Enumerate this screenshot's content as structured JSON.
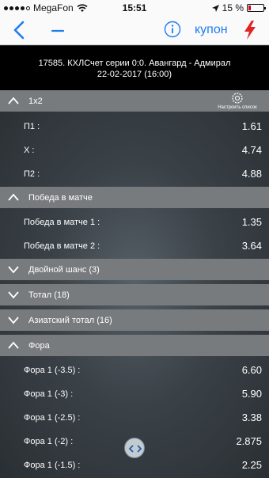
{
  "statusbar": {
    "carrier": "MegaFon",
    "time": "15:51",
    "battery_text": "15 %",
    "battery_level": 0.15
  },
  "navbar": {
    "coupon_label": "купон",
    "accent_color": "#1e7cf2",
    "bolt_color": "#e02424"
  },
  "match": {
    "title": "17585. КХЛСчет серии 0:0. Авангард - Адмирал",
    "datetime": "22-02-2017 (16:00)"
  },
  "settings": {
    "label": "Настроить список"
  },
  "sections": [
    {
      "title": "1x2",
      "expanded": true,
      "rows": [
        {
          "label": "П1 :",
          "odds": "1.61"
        },
        {
          "label": "Х :",
          "odds": "4.74"
        },
        {
          "label": "П2 :",
          "odds": "4.88"
        }
      ]
    },
    {
      "title": "Победа в матче",
      "expanded": true,
      "rows": [
        {
          "label": "Победа в матче 1 :",
          "odds": "1.35"
        },
        {
          "label": "Победа в матче 2 :",
          "odds": "3.64"
        }
      ]
    },
    {
      "title": "Двойной шанс (3)",
      "expanded": false,
      "rows": []
    },
    {
      "title": "Тотал (18)",
      "expanded": false,
      "rows": []
    },
    {
      "title": "Азиатский тотал (16)",
      "expanded": false,
      "rows": []
    },
    {
      "title": "Фора",
      "expanded": true,
      "rows": [
        {
          "label": "Фора 1 (-3.5) :",
          "odds": "6.60"
        },
        {
          "label": "Фора 1 (-3) :",
          "odds": "5.90"
        },
        {
          "label": "Фора 1 (-2.5) :",
          "odds": "3.38"
        },
        {
          "label": "Фора 1 (-2) :",
          "odds": "2.875"
        },
        {
          "label": "Фора 1 (-1.5) :",
          "odds": "2.25"
        }
      ]
    }
  ]
}
